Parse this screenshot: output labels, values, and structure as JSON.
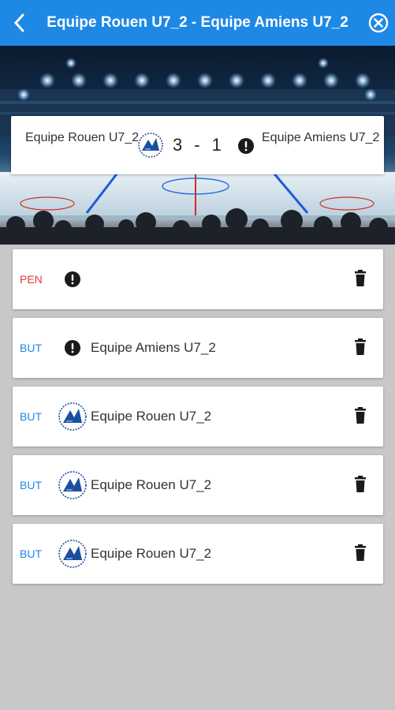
{
  "header": {
    "title": "Equipe Rouen U7_2 - Equipe Amiens U7_2",
    "back_icon": "chevron-left-icon",
    "close_icon": "close-circle-icon",
    "background_color": "#1e88e5"
  },
  "match": {
    "home_team": "Equipe Rouen U7_2",
    "home_score": "3",
    "separator": "-",
    "away_score": "1",
    "away_team": "Equipe Amiens U7_2"
  },
  "events": [
    {
      "type": "PEN",
      "team": "",
      "icon": "alert-icon"
    },
    {
      "type": "BUT",
      "team": "Equipe Amiens U7_2",
      "icon": "alert-icon"
    },
    {
      "type": "BUT",
      "team": "Equipe Rouen U7_2",
      "icon": "team-logo-icon"
    },
    {
      "type": "BUT",
      "team": "Equipe Rouen U7_2",
      "icon": "team-logo-icon"
    },
    {
      "type": "BUT",
      "team": "Equipe Rouen U7_2",
      "icon": "team-logo-icon"
    }
  ],
  "colors": {
    "pen": "#e53935",
    "but": "#1e88e5"
  }
}
